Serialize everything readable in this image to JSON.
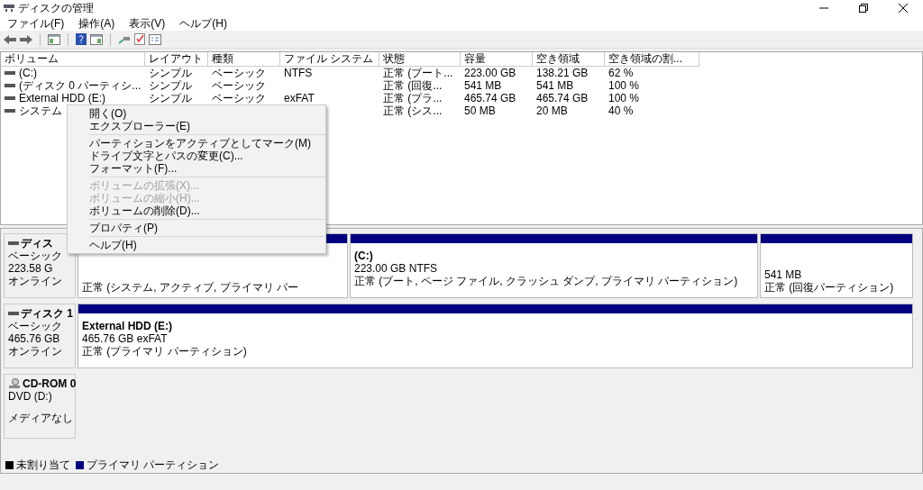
{
  "window": {
    "title": "ディスクの管理"
  },
  "menu_bar": [
    "ファイル(F)",
    "操作(A)",
    "表示(V)",
    "ヘルプ(H)"
  ],
  "volume_table": {
    "columns": [
      "ボリューム",
      "レイアウト",
      "種類",
      "ファイル システム",
      "状態",
      "容量",
      "空き領域",
      "空き領域の割..."
    ],
    "rows": [
      {
        "cells": [
          "(C:)",
          "シンプル",
          "ベーシック",
          "NTFS",
          "正常 (ブート...",
          "223.00 GB",
          "138.21 GB",
          "62 %"
        ]
      },
      {
        "cells": [
          "(ディスク 0 パーティシ...",
          "シンプル",
          "ベーシック",
          "",
          "正常 (回復...",
          "541 MB",
          "541 MB",
          "100 %"
        ]
      },
      {
        "cells": [
          "External HDD (E:)",
          "シンプル",
          "ベーシック",
          "exFAT",
          "正常 (プラ...",
          "465.74 GB",
          "465.74 GB",
          "100 %"
        ]
      },
      {
        "cells": [
          "システム",
          "",
          "",
          "",
          "正常 (シス...",
          "50 MB",
          "20 MB",
          "40 %"
        ]
      }
    ]
  },
  "disks": [
    {
      "kind": "disk",
      "name": "ディス",
      "lines": [
        "ベーシック",
        "223.58 G",
        "オンライン"
      ],
      "partitions": [
        {
          "lines": [
            "正常 (システム, アクティブ, プライマリ パー"
          ]
        },
        {
          "name": "(C:)",
          "lines": [
            "223.00 GB NTFS",
            "正常 (ブート, ページ ファイル, クラッシュ ダンプ, プライマリ パーティション)"
          ]
        },
        {
          "lines": [
            "541 MB",
            "正常 (回復パーティション)"
          ]
        }
      ]
    },
    {
      "kind": "disk",
      "name": "ディスク 1",
      "lines": [
        "ベーシック",
        "465.76 GB",
        "オンライン"
      ],
      "partitions": [
        {
          "name": "External HDD  (E:)",
          "lines": [
            "465.76 GB exFAT",
            "正常 (プライマリ パーティション)"
          ]
        }
      ]
    },
    {
      "kind": "cdrom",
      "name": "CD-ROM 0",
      "lines": [
        "DVD (D:)",
        "メディアなし"
      ]
    }
  ],
  "legend": [
    {
      "label": "未割り当て",
      "color": "#000000"
    },
    {
      "label": "プライマリ パーティション",
      "color": "#000080"
    }
  ],
  "context_menu": {
    "groups": [
      [
        {
          "label": "開く(O)",
          "disabled": false
        },
        {
          "label": "エクスプローラー(E)",
          "disabled": false
        }
      ],
      [
        {
          "label": "パーティションをアクティブとしてマーク(M)",
          "disabled": false
        },
        {
          "label": "ドライブ文字とパスの変更(C)...",
          "disabled": false
        },
        {
          "label": "フォーマット(F)...",
          "disabled": false
        }
      ],
      [
        {
          "label": "ボリュームの拡張(X)...",
          "disabled": true
        },
        {
          "label": "ボリュームの縮小(H)...",
          "disabled": true
        },
        {
          "label": "ボリュームの削除(D)...",
          "disabled": false
        }
      ],
      [
        {
          "label": "プロパティ(P)",
          "disabled": false
        }
      ],
      [
        {
          "label": "ヘルプ(H)",
          "disabled": false
        }
      ]
    ]
  }
}
